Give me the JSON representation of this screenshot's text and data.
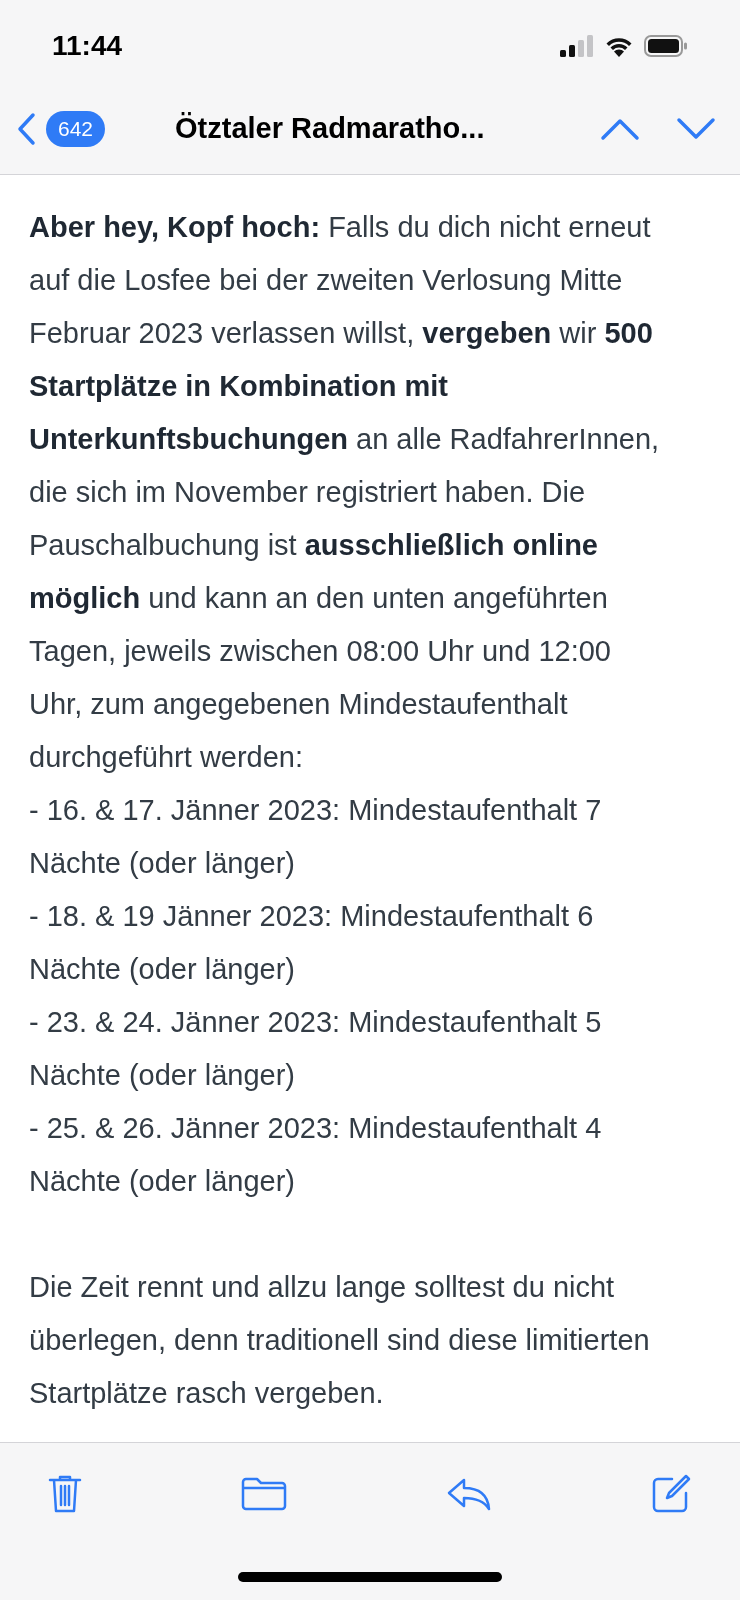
{
  "status_bar": {
    "time": "11:44"
  },
  "nav": {
    "unread_count": "642",
    "title": "Ötztaler Radmaratho..."
  },
  "body": [
    {
      "lines": [
        "**Aber hey, Kopf hoch:** Falls du dich nicht erneut auf die Losfee bei der zweiten Verlosung Mitte Februar 2023 verlassen willst, **vergeben** wir **500 Startplätze in Kombination mit Unterkunftsbuchungen** an alle RadfahrerInnen, die sich im November registriert haben. Die Pauschalbuchung ist **ausschließlich online möglich** und kann an den unten angeführten Tagen, jeweils zwischen 08:00 Uhr und 12:00 Uhr, zum angegebenen Mindestaufenthalt durchgeführt werden:",
        "- 16. & 17. Jänner 2023: Mindestaufenthalt 7 Nächte (oder länger)",
        "- 18. & 19 Jänner 2023: Mindestaufenthalt 6 Nächte (oder länger)",
        "- 23. & 24. Jänner 2023: Mindestaufenthalt 5 Nächte (oder länger)",
        "- 25. & 26. Jänner 2023: Mindestaufenthalt 4 Nächte (oder länger)"
      ]
    },
    {
      "lines": [
        "Die Zeit rennt und allzu lange solltest du nicht überlegen, denn traditionell sind diese limitierten Startplätze rasch vergeben."
      ]
    }
  ]
}
